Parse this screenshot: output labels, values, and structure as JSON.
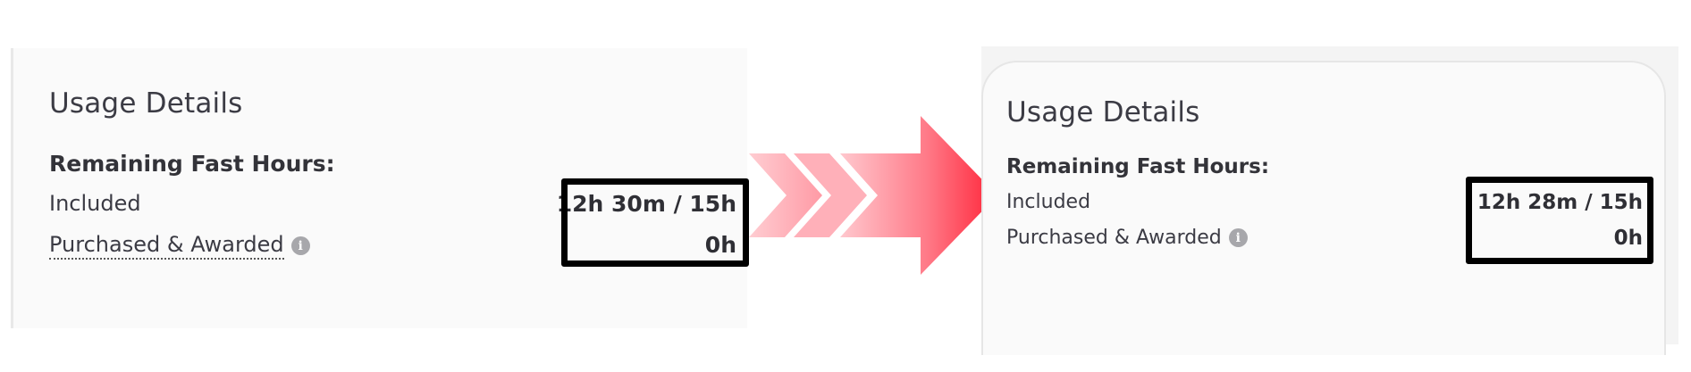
{
  "left": {
    "title": "Usage Details",
    "subhead": "Remaining Fast Hours:",
    "included_label": "Included",
    "purchased_label": "Purchased & Awarded",
    "included_value": "12h 30m / 15h",
    "purchased_value": "0h"
  },
  "right": {
    "title": "Usage Details",
    "subhead": "Remaining Fast Hours:",
    "included_label": "Included",
    "purchased_label": "Purchased & Awarded",
    "included_value": "12h 28m / 15h",
    "purchased_value": "0h"
  },
  "icons": {
    "info": "info-icon",
    "arrow": "right-arrow-icon"
  },
  "colors": {
    "highlight_border": "#000000",
    "arrow_light": "#ffc4cb",
    "arrow_dark": "#ff2a3e"
  }
}
